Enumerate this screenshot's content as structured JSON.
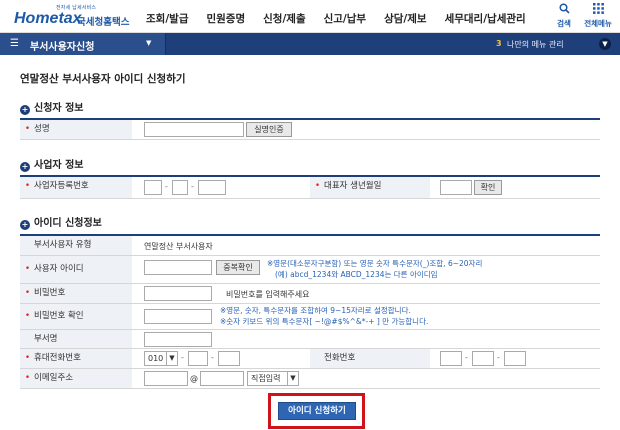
{
  "header": {
    "logo_tagline": "전자세 납세서비스",
    "logo_brand": "Hometax",
    "logo_kr": "국세청홈택스",
    "nav": [
      "조회/발급",
      "민원증명",
      "신청/제출",
      "신고/납부",
      "상담/제보",
      "세무대리/납세관리"
    ],
    "search_label": "검색",
    "allmenu_label": "전체메뉴"
  },
  "navbar": {
    "menu_title": "부서사용자신청",
    "my_menu_count": "3",
    "my_menu_label": "나만의 메뉴 관리"
  },
  "page_title": "연말정산 부서사용자 아이디 신청하기",
  "applicant": {
    "section_title": "신청자 정보",
    "name_label": "성명",
    "verify_button": "실명인증"
  },
  "business": {
    "section_title": "사업자 정보",
    "biz_no_label": "사업자등록번호",
    "ceo_birth_label": "대표자 생년월일",
    "confirm_button": "확인"
  },
  "account": {
    "section_title": "아이디 신청정보",
    "type_label": "부서사용자 유형",
    "type_value": "연말정산 부서사용자",
    "id_label": "사용자 아이디",
    "dup_button": "중복확인",
    "id_note_1": "※영문(대소문자구분함) 또는 영문 숫자 특수문자(_)조합, 6~20자리",
    "id_note_2": "(예) abcd_1234와 ABCD_1234는 다른 아이디임",
    "pw_label": "비밀번호",
    "pw_hint": "비밀번호를 입력해주세요",
    "pw_confirm_label": "비밀번호 확인",
    "pw_note_1": "※영문, 숫자, 특수문자를 조합하여 9~15자리로 설정합니다.",
    "pw_note_2": "※숫자 키보드 위의 특수문자[ ~!@#$%^&*-+ ] 만 가능합니다.",
    "dept_label": "부서명",
    "mobile_label": "휴대전화번호",
    "mobile_prefix": "010",
    "phone_label": "전화번호",
    "email_label": "이메일주소",
    "email_at": "@",
    "email_domain_option": "직접입력"
  },
  "submit_label": "아이디 신청하기",
  "colors": {
    "primary": "#1f3f7a",
    "button": "#2f66b3",
    "highlight": "#d0121b",
    "required": "#dd2222"
  }
}
